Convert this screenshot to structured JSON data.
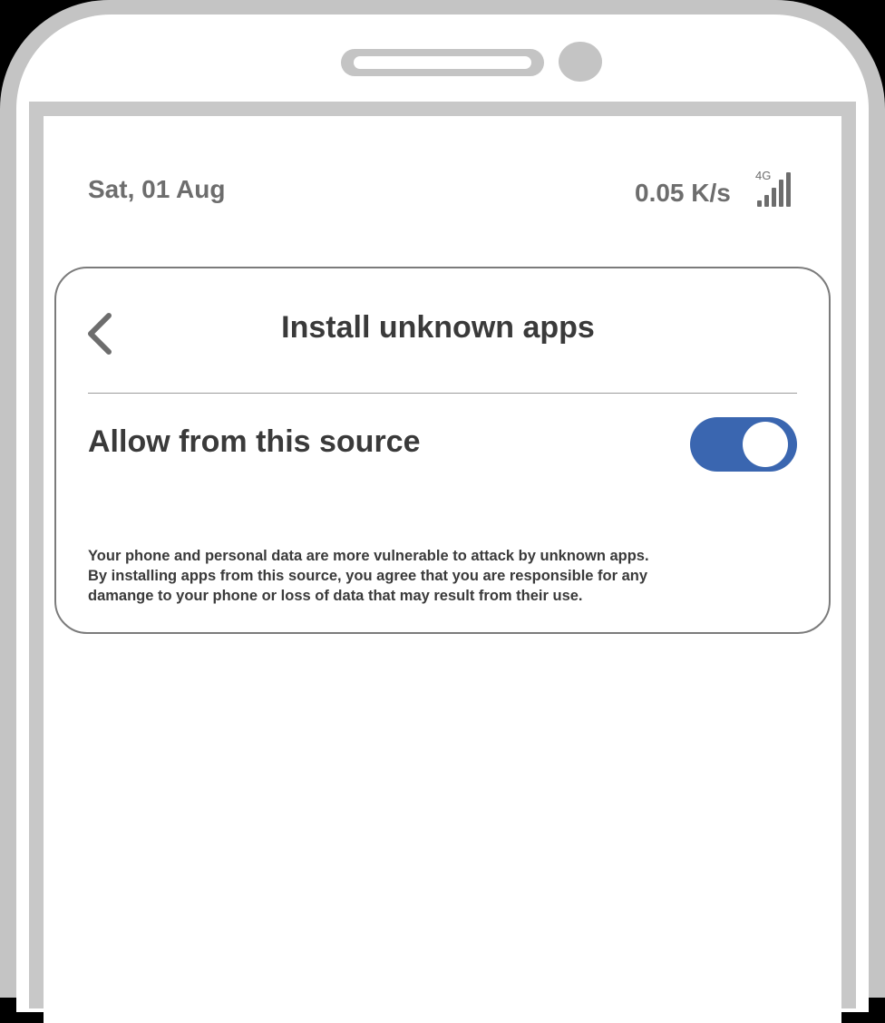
{
  "status_bar": {
    "date": "Sat, 01 Aug",
    "speed": "0.05 K/s",
    "network": "4G"
  },
  "header": {
    "title": "Install unknown apps",
    "back_icon": "chevron-left-icon"
  },
  "setting": {
    "label": "Allow from this source",
    "enabled": true
  },
  "warning": {
    "line1": "Your phone and personal data are more vulnerable to attack by unknown apps.",
    "line2": "By installing apps from this source, you agree that you are responsible for any",
    "line3": "damange to your phone or loss of data that may result from their use."
  },
  "colors": {
    "toggle_on": "#3a66b0",
    "text": "#3a3a3a",
    "muted_text": "#6d6d6d"
  }
}
